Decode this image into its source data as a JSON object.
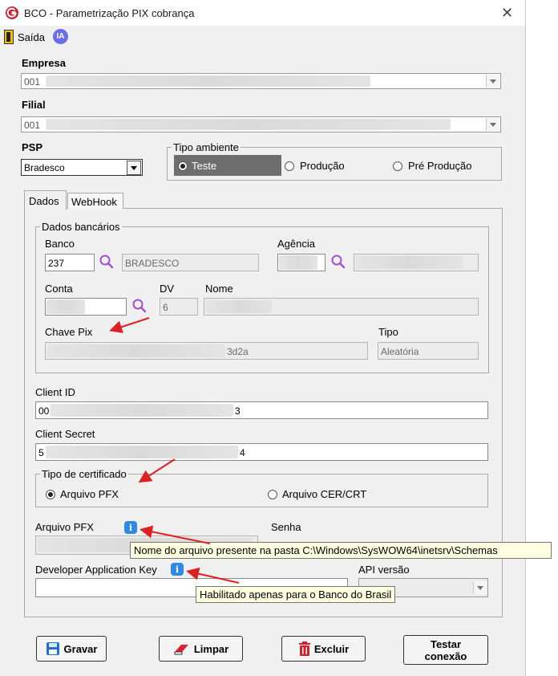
{
  "window": {
    "title": "BCO - Parametrização PIX cobrança"
  },
  "menu": {
    "exit_label": "Saída",
    "ai_badge": "IA"
  },
  "empresa": {
    "label": "Empresa",
    "value": "001"
  },
  "filial": {
    "label": "Filial",
    "value": "001"
  },
  "psp": {
    "label": "PSP",
    "value": "Bradesco"
  },
  "ambiente": {
    "label": "Tipo ambiente",
    "options": [
      "Teste",
      "Produção",
      "Pré Produção"
    ],
    "selected": "Teste"
  },
  "tabs": [
    {
      "label": "Dados"
    },
    {
      "label": "WebHook"
    }
  ],
  "dados_bancarios": {
    "label": "Dados bancários",
    "banco_label": "Banco",
    "banco_codigo": "237",
    "banco_nome": "BRADESCO",
    "agencia_label": "Agência",
    "conta_label": "Conta",
    "dv_label": "DV",
    "dv_value": "6",
    "nome_label": "Nome",
    "chave_label": "Chave Pix",
    "chave_value": "3d2a",
    "tipo_label": "Tipo",
    "tipo_value": "Aleatória"
  },
  "client_id": {
    "label": "Client ID",
    "value_start": "00",
    "value_end": "3"
  },
  "client_secret": {
    "label": "Client Secret",
    "value_start": "5",
    "value_end": "4"
  },
  "certificado": {
    "label": "Tipo de certificado",
    "options": [
      "Arquivo PFX",
      "Arquivo CER/CRT"
    ],
    "selected": "Arquivo PFX"
  },
  "arquivo_pfx": {
    "label": "Arquivo PFX",
    "tooltip": "Nome do arquivo presente na pasta C:\\Windows\\SysWOW64\\inetsrv\\Schemas"
  },
  "senha": {
    "label": "Senha"
  },
  "dev_key": {
    "label": "Developer Application Key",
    "tooltip": "Habilitado apenas para o Banco do Brasil"
  },
  "api_versao": {
    "label": "API versão"
  },
  "buttons": {
    "gravar": "Gravar",
    "limpar": "Limpar",
    "excluir": "Excluir",
    "testar_line1": "Testar",
    "testar_line2": "conexão"
  },
  "colors": {
    "accent": "#2e8ae6",
    "annotation_arrow": "#e02020",
    "tooltip_bg": "#ffffe1"
  }
}
